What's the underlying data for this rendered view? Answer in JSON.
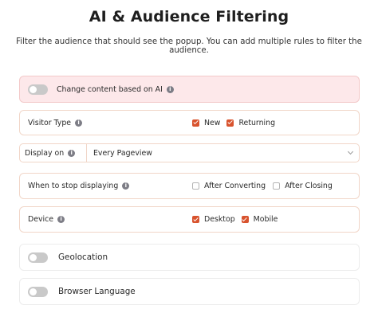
{
  "header": {
    "title": "AI & Audience Filtering",
    "subtitle": "Filter the audience that should see the popup. You can add multiple rules to filter the audience."
  },
  "ai": {
    "label": "Change content based on AI",
    "enabled": false
  },
  "visitor_type": {
    "label": "Visitor Type",
    "options": [
      {
        "label": "New",
        "checked": true
      },
      {
        "label": "Returning",
        "checked": true
      }
    ]
  },
  "display_on": {
    "label": "Display on",
    "value": "Every Pageview"
  },
  "stop_displaying": {
    "label": "When to stop displaying",
    "options": [
      {
        "label": "After Converting",
        "checked": false
      },
      {
        "label": "After Closing",
        "checked": false
      }
    ]
  },
  "device": {
    "label": "Device",
    "options": [
      {
        "label": "Desktop",
        "checked": true
      },
      {
        "label": "Mobile",
        "checked": true
      }
    ]
  },
  "geolocation": {
    "label": "Geolocation",
    "enabled": false
  },
  "browser_language": {
    "label": "Browser Language",
    "enabled": false
  },
  "colors": {
    "accent": "#d8532e",
    "ai_background": "#fde8ea",
    "border": "#f1d6c8"
  },
  "icons": [
    "info-icon",
    "chevron-down-icon",
    "toggle-switch"
  ]
}
